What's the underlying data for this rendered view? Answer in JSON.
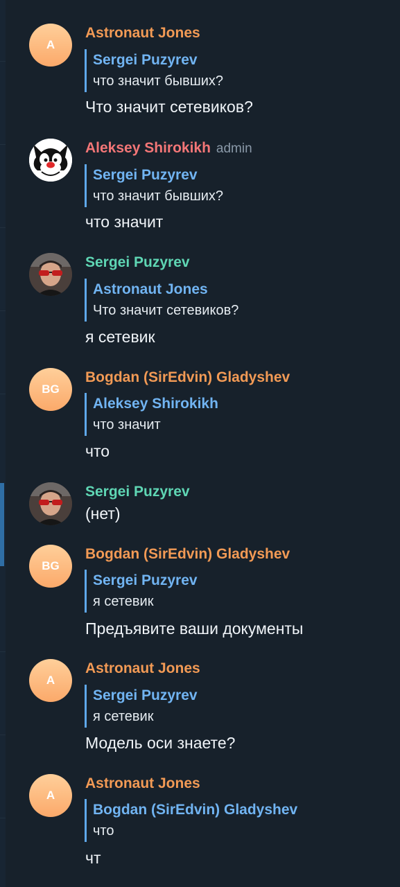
{
  "messages": [
    {
      "author": "Astronaut Jones",
      "author_color": "#f29a55",
      "avatar": {
        "type": "initials",
        "initials": "A",
        "icon": "initials-avatar"
      },
      "reply": {
        "author": "Sergei Puzyrev",
        "text": "что значит бывших?"
      },
      "text": "Что значит сетевиков?"
    },
    {
      "author": "Aleksey Shirokikh",
      "author_color": "#f37677",
      "badge": "admin",
      "avatar": {
        "type": "image",
        "icon": "cartoon-cat-avatar"
      },
      "reply": {
        "author": "Sergei Puzyrev",
        "text": "что значит бывших?"
      },
      "text": "что значит"
    },
    {
      "author": "Sergei Puzyrev",
      "author_color": "#5fd6b4",
      "avatar": {
        "type": "image",
        "icon": "user-photo-avatar"
      },
      "reply": {
        "author": "Astronaut Jones",
        "text": "Что значит сетевиков?"
      },
      "text": "я сетевик"
    },
    {
      "author": "Bogdan (SirEdvin) Gladyshev",
      "author_color": "#f29a55",
      "avatar": {
        "type": "initials",
        "initials": "BG",
        "icon": "initials-avatar"
      },
      "reply": {
        "author": "Aleksey Shirokikh",
        "text": "что значит"
      },
      "text": "что"
    },
    {
      "author": "Sergei Puzyrev",
      "author_color": "#5fd6b4",
      "avatar": {
        "type": "image",
        "icon": "user-photo-avatar"
      },
      "text": "(нет)"
    },
    {
      "author": "Bogdan (SirEdvin) Gladyshev",
      "author_color": "#f29a55",
      "avatar": {
        "type": "initials",
        "initials": "BG",
        "icon": "initials-avatar"
      },
      "reply": {
        "author": "Sergei Puzyrev",
        "text": "я сетевик"
      },
      "text": "Предъявите ваши документы"
    },
    {
      "author": "Astronaut Jones",
      "author_color": "#f29a55",
      "avatar": {
        "type": "initials",
        "initials": "A",
        "icon": "initials-avatar"
      },
      "reply": {
        "author": "Sergei Puzyrev",
        "text": "я сетевик"
      },
      "text": "Модель оси знаете?"
    },
    {
      "author": "Astronaut Jones",
      "author_color": "#f29a55",
      "avatar": {
        "type": "initials",
        "initials": "A",
        "icon": "initials-avatar"
      },
      "reply": {
        "author": "Bogdan (SirEdvin) Gladyshev",
        "text": "что"
      },
      "text": "чт"
    }
  ],
  "colors": {
    "background": "#17212b",
    "reply_bar": "#5fa8ea",
    "reply_author": "#71b4f2",
    "message_text": "#f0f4f8"
  }
}
